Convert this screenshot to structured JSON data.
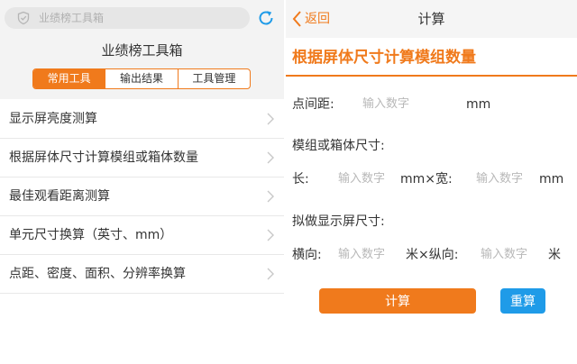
{
  "left": {
    "search": {
      "placeholder": "业绩榜工具箱"
    },
    "title": "业绩榜工具箱",
    "tabs": [
      {
        "label": "常用工具",
        "active": true
      },
      {
        "label": "输出结果",
        "active": false
      },
      {
        "label": "工具管理",
        "active": false
      }
    ],
    "menu": [
      {
        "label": "显示屏亮度测算"
      },
      {
        "label": "根据屏体尺寸计算模组或箱体数量"
      },
      {
        "label": "最佳观看距离测算"
      },
      {
        "label": "单元尺寸换算（英寸、mm）"
      },
      {
        "label": "点距、密度、面积、分辨率换算"
      }
    ]
  },
  "right": {
    "back_label": "返回",
    "title": "计算",
    "heading": "根据屏体尺寸计算模组数量",
    "pitch": {
      "label": "点间距:",
      "placeholder": "输入数字",
      "unit": "mm"
    },
    "module_label": "模组或箱体尺寸:",
    "module": {
      "length_label": "长:",
      "length_placeholder": "输入数字",
      "mid_unit": "mm×宽:",
      "width_placeholder": "输入数字",
      "unit": "mm"
    },
    "screen_label": "拟做显示屏尺寸:",
    "screen": {
      "h_label": "横向:",
      "h_placeholder": "输入数字",
      "mid_unit": "米×纵向:",
      "v_placeholder": "输入数字",
      "unit": "米"
    },
    "calc_button": "计算",
    "reset_button": "重算"
  },
  "colors": {
    "accent": "#f07a1c",
    "blue": "#1f9be8"
  },
  "icons": [
    "shield-icon",
    "refresh-icon",
    "chevron-right-icon",
    "back-chevron-icon"
  ]
}
